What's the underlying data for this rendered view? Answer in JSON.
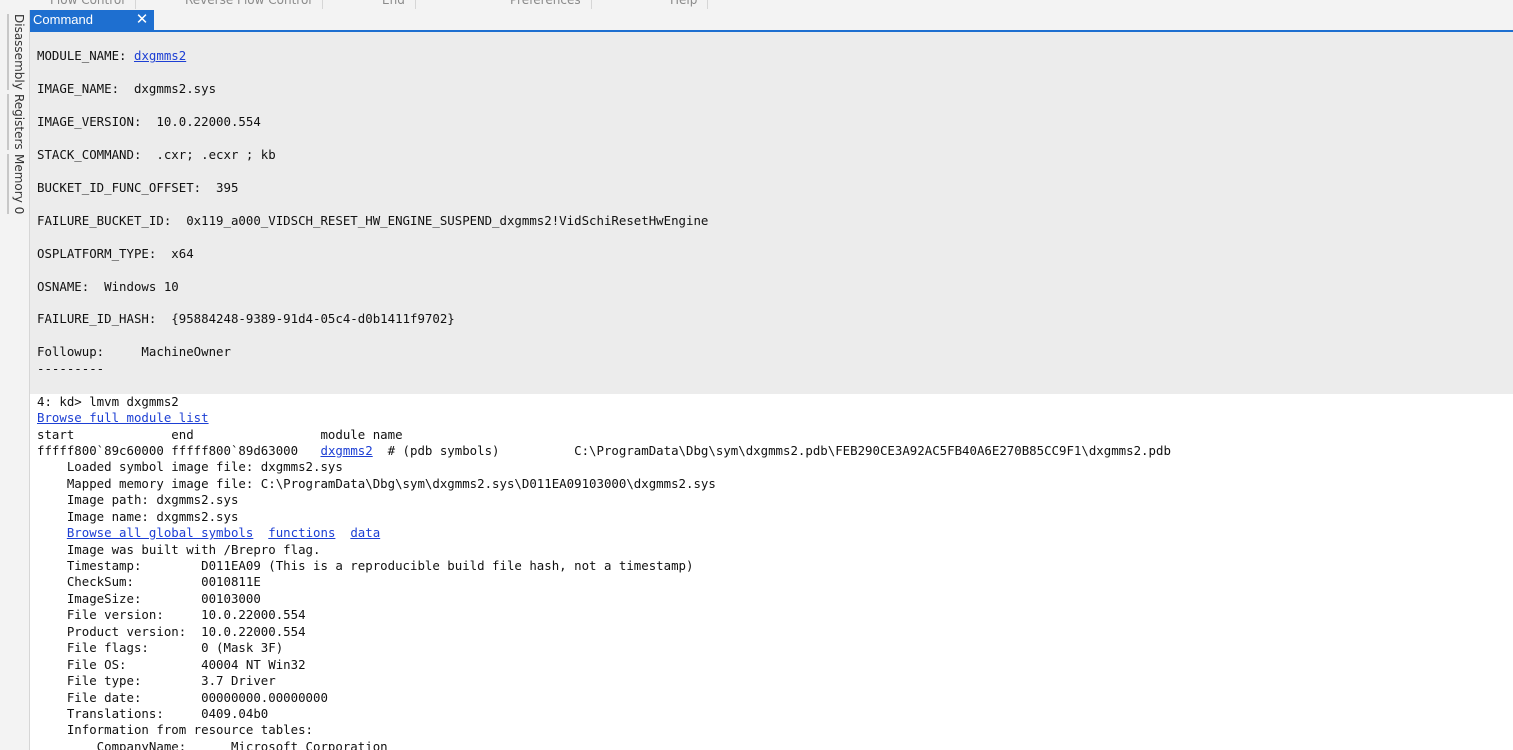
{
  "ribbon": {
    "tabs": [
      "Flow Control",
      "Reverse Flow Control",
      "End",
      "Preferences",
      "Help"
    ]
  },
  "sidebar": {
    "tabs": [
      "Disassembly",
      "Registers",
      "Memory 0"
    ]
  },
  "document_tab": {
    "title": "Command",
    "close_icon": "close-icon"
  },
  "output": {
    "summary": {
      "module_name_label": "MODULE_NAME: ",
      "module_name_link": "dxgmms2",
      "image_name": "IMAGE_NAME:  dxgmms2.sys",
      "image_version": "IMAGE_VERSION:  10.0.22000.554",
      "stack_command": "STACK_COMMAND:  .cxr; .ecxr ; kb",
      "bucket_id_func_offset": "BUCKET_ID_FUNC_OFFSET:  395",
      "failure_bucket_id": "FAILURE_BUCKET_ID:  0x119_a000_VIDSCH_RESET_HW_ENGINE_SUSPEND_dxgmms2!VidSchiResetHwEngine",
      "osplatform_type": "OSPLATFORM_TYPE:  x64",
      "osname": "OSNAME:  Windows 10",
      "failure_id_hash": "FAILURE_ID_HASH:  {95884248-9389-91d4-05c4-d0b1411f9702}",
      "followup": "Followup:     MachineOwner",
      "separator": "---------"
    },
    "command_prompt": "4: kd> lmvm dxgmms2",
    "browse_full_module_list": "Browse full module list",
    "header_row": "start             end                 module name",
    "module_row": {
      "prefix": "fffff800`89c60000 fffff800`89d63000   ",
      "link": "dxgmms2",
      "suffix": "  # (pdb symbols)          C:\\ProgramData\\Dbg\\sym\\dxgmms2.pdb\\FEB290CE3A92AC5FB40A6E270B85CC9F1\\dxgmms2.pdb"
    },
    "details": [
      "    Loaded symbol image file: dxgmms2.sys",
      "    Mapped memory image file: C:\\ProgramData\\Dbg\\sym\\dxgmms2.sys\\D011EA09103000\\dxgmms2.sys",
      "    Image path: dxgmms2.sys",
      "    Image name: dxgmms2.sys"
    ],
    "browse_links": {
      "indent": "    ",
      "global_symbols": "Browse all global symbols",
      "functions": "functions",
      "data": "data"
    },
    "details2": [
      "    Image was built with /Brepro flag.",
      "    Timestamp:        D011EA09 (This is a reproducible build file hash, not a timestamp)",
      "    CheckSum:         0010811E",
      "    ImageSize:        00103000",
      "    File version:     10.0.22000.554",
      "    Product version:  10.0.22000.554",
      "    File flags:       0 (Mask 3F)",
      "    File OS:          40004 NT Win32",
      "    File type:        3.7 Driver",
      "    File date:        00000000.00000000",
      "    Translations:     0409.04b0",
      "    Information from resource tables:",
      "        CompanyName:      Microsoft Corporation"
    ]
  },
  "colors": {
    "accent": "#1e6fd0",
    "link": "#1d3fd4",
    "highlight_background": "#ececec"
  }
}
